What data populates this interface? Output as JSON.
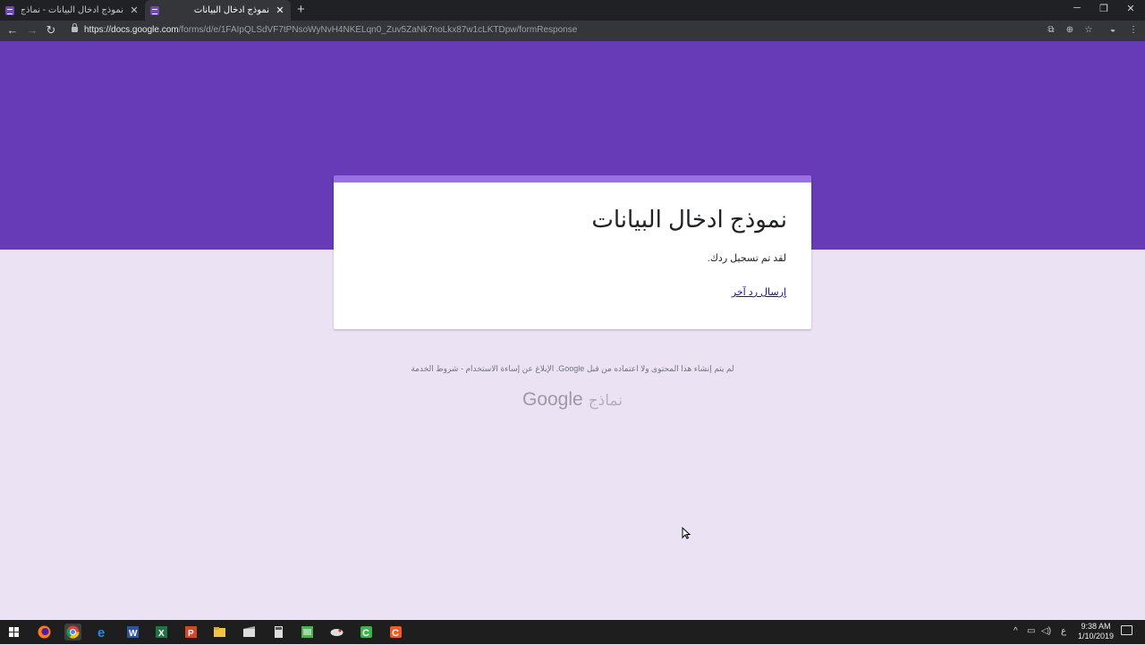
{
  "browser": {
    "tabs": [
      {
        "title": "نموذج ادخال البيانات - نماذج Google"
      },
      {
        "title": "نموذج ادخال البيانات"
      }
    ],
    "new_tab_label": "+",
    "url_host": "https://docs.google.com",
    "url_path": "/forms/d/e/1FAIpQLSdVF7tPNsoWyNvH4NKELqn0_Zuv5ZaNk7noLkx87w1cLKTDpw/formResponse"
  },
  "colors": {
    "banner": "#673ab7",
    "card_accent": "#9a70e3",
    "page_background": "#ebe3f4"
  },
  "form": {
    "title": "نموذج ادخال البيانات",
    "confirmation": "لقد تم تسجيل ردك.",
    "submit_another_label": "إرسال رد آخر"
  },
  "footer": {
    "disclaimer": "لم يتم إنشاء هذا المحتوى ولا اعتماده من قبل Google. الإبلاغ عن إساءة الاستخدام - شروط الخدمة",
    "logo_google": "Google",
    "logo_forms": "نماذج"
  },
  "taskbar": {
    "time": "9:38 AM",
    "date": "1/10/2019",
    "language_indicator": "ع",
    "apps": [
      "windows-start",
      "firefox",
      "chrome",
      "edge",
      "word",
      "excel",
      "powerpoint",
      "file-explorer",
      "video-editor",
      "calculator",
      "green-app",
      "bird-app",
      "camtasia-green",
      "camtasia-orange"
    ]
  }
}
